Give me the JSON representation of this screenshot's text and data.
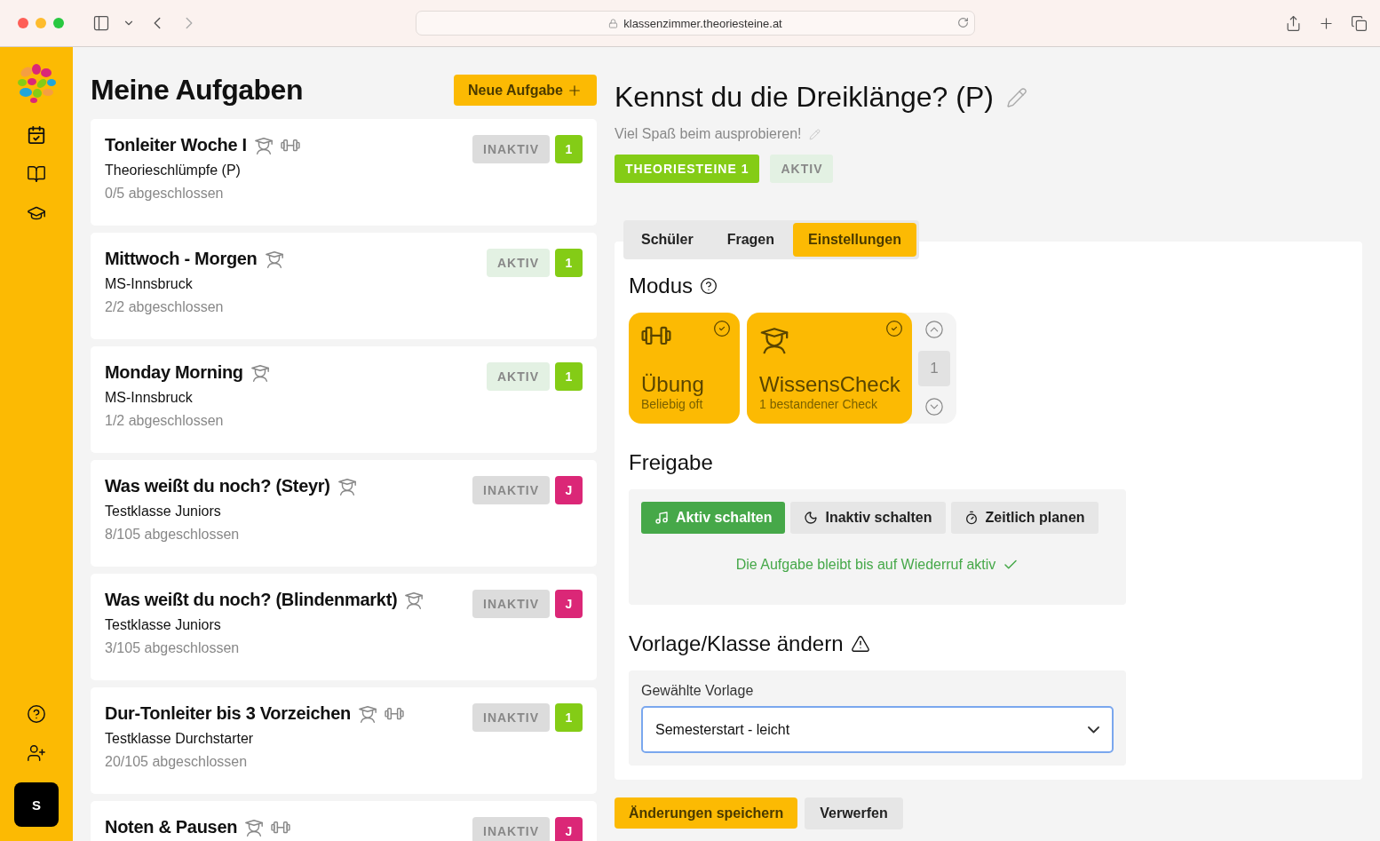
{
  "browser": {
    "url": "klassenzimmer.theoriesteine.at"
  },
  "sidebar": {
    "avatar": "S"
  },
  "list": {
    "title": "Meine Aufgaben",
    "new_button": "Neue Aufgabe",
    "tasks": [
      {
        "title": "Tonleiter Woche I",
        "check": true,
        "practice": true,
        "class": "Theorieschlümpfe (P)",
        "progress": "0/5 abgeschlossen",
        "status": "INAKTIV",
        "active": false,
        "badge": "1",
        "color": "#84cc16"
      },
      {
        "title": "Mittwoch - Morgen",
        "check": true,
        "practice": false,
        "class": "MS-Innsbruck",
        "progress": "2/2 abgeschlossen",
        "status": "AKTIV",
        "active": true,
        "badge": "1",
        "color": "#84cc16"
      },
      {
        "title": "Monday Morning",
        "check": true,
        "practice": false,
        "class": "MS-Innsbruck",
        "progress": "1/2 abgeschlossen",
        "status": "AKTIV",
        "active": true,
        "badge": "1",
        "color": "#84cc16"
      },
      {
        "title": "Was weißt du noch? (Steyr)",
        "check": true,
        "practice": false,
        "class": "Testklasse Juniors",
        "progress": "8/105 abgeschlossen",
        "status": "INAKTIV",
        "active": false,
        "badge": "J",
        "color": "#db2777"
      },
      {
        "title": "Was weißt du noch? (Blindenmarkt)",
        "check": true,
        "practice": false,
        "class": "Testklasse Juniors",
        "progress": "3/105 abgeschlossen",
        "status": "INAKTIV",
        "active": false,
        "badge": "J",
        "color": "#db2777"
      },
      {
        "title": "Dur-Tonleiter bis 3 Vorzeichen",
        "check": true,
        "practice": true,
        "class": "Testklasse Durchstarter",
        "progress": "20/105 abgeschlossen",
        "status": "INAKTIV",
        "active": false,
        "badge": "1",
        "color": "#84cc16"
      },
      {
        "title": "Noten & Pausen",
        "check": true,
        "practice": true,
        "status": "INAKTIV",
        "active": false,
        "badge": "J",
        "color": "#db2777"
      }
    ]
  },
  "detail": {
    "title": "Kennst du die Dreiklänge? (P)",
    "subtitle": "Viel Spaß beim ausprobieren!",
    "class_tag": "THEORIESTEINE 1",
    "status_tag": "AKTIV",
    "active": true,
    "tabs": [
      {
        "label": "Schüler",
        "selected": false
      },
      {
        "label": "Fragen",
        "selected": false
      },
      {
        "label": "Einstellungen",
        "selected": true
      }
    ],
    "mode_section": {
      "heading": "Modus",
      "modes": [
        {
          "kind": "practice",
          "title": "Übung",
          "subtitle": "Beliebig oft",
          "checked": true
        },
        {
          "kind": "check",
          "title": "WissensCheck",
          "subtitle": "1 bestandener Check",
          "checked": true
        }
      ],
      "count": "1"
    },
    "release_section": {
      "heading": "Freigabe",
      "buttons": [
        {
          "kind": "active",
          "label": "Aktiv schalten",
          "selected": true
        },
        {
          "kind": "inactive",
          "label": "Inaktiv schalten",
          "selected": false
        },
        {
          "kind": "schedule",
          "label": "Zeitlich planen",
          "selected": false
        }
      ],
      "message": "Die Aufgabe bleibt bis auf Wiederruf aktiv"
    },
    "template_section": {
      "heading": "Vorlage/Klasse ändern",
      "field_label": "Gewählte Vorlage",
      "value": "Semesterstart - leicht"
    },
    "actions": {
      "save": "Änderungen speichern",
      "discard": "Verwerfen"
    }
  }
}
